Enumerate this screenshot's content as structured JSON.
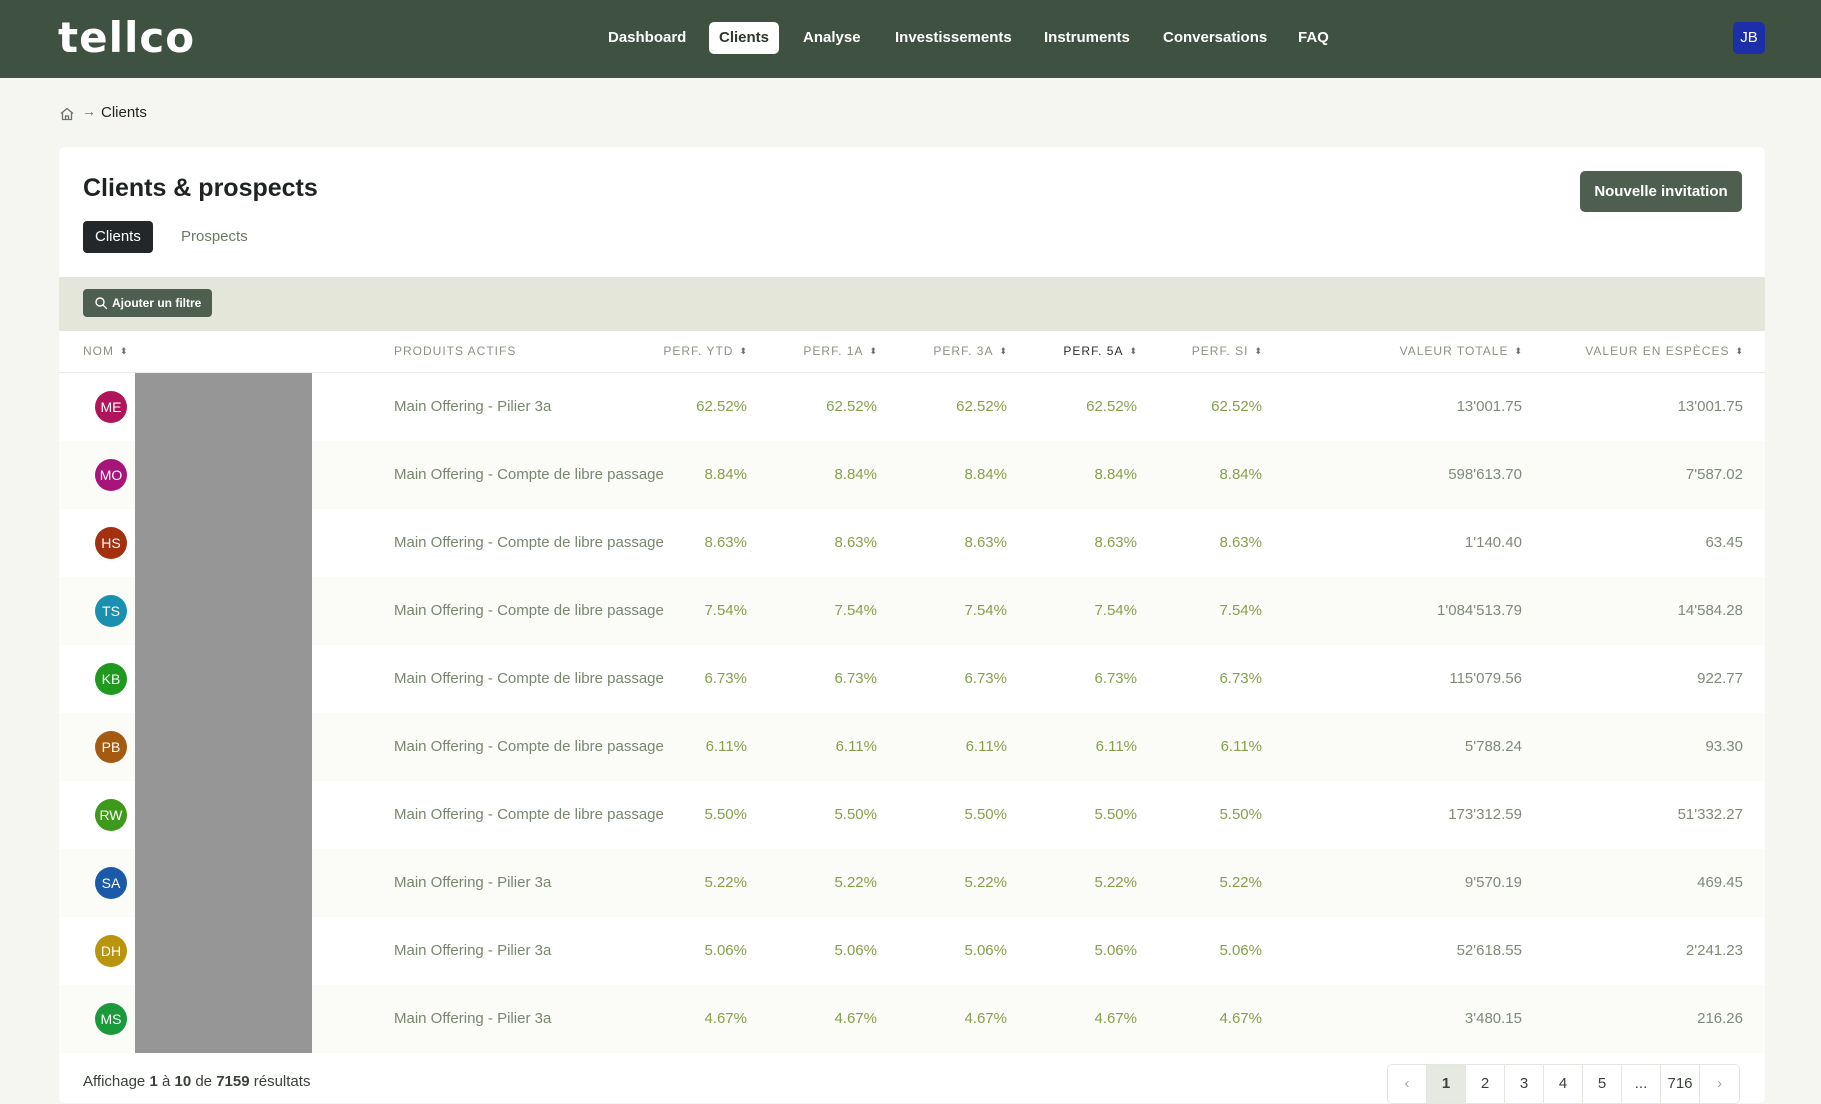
{
  "app": {
    "logo": "tellco"
  },
  "nav": {
    "items": [
      {
        "label": "Dashboard",
        "active": false
      },
      {
        "label": "Clients",
        "active": true
      },
      {
        "label": "Analyse",
        "active": false
      },
      {
        "label": "Investissements",
        "active": false
      },
      {
        "label": "Instruments",
        "active": false
      },
      {
        "label": "Conversations",
        "active": false
      },
      {
        "label": "FAQ",
        "active": false
      }
    ],
    "user_initials": "JB"
  },
  "breadcrumb": {
    "arrow": "→",
    "current": "Clients"
  },
  "page": {
    "title": "Clients & prospects",
    "invite_label": "Nouvelle invitation",
    "tabs": [
      {
        "label": "Clients",
        "active": true
      },
      {
        "label": "Prospects",
        "active": false
      }
    ],
    "filter_label": "Ajouter un filtre"
  },
  "table": {
    "columns": [
      {
        "label": "Nom"
      },
      {
        "label": "Produits actifs"
      },
      {
        "label": "Perf. YTD"
      },
      {
        "label": "Perf. 1A"
      },
      {
        "label": "Perf. 3A"
      },
      {
        "label": "Perf. 5A"
      },
      {
        "label": "Perf. SI"
      },
      {
        "label": "Valeur totale"
      },
      {
        "label": "Valeur en espèces"
      }
    ],
    "sort_icon": "⬍",
    "rows": [
      {
        "initials": "ME",
        "color": "#b0155a",
        "product": "Main Offering - Pilier 3a",
        "ytd": "62.52%",
        "p1a": "62.52%",
        "p3a": "62.52%",
        "p5a": "62.52%",
        "psi": "62.52%",
        "total": "13'001.75",
        "cash": "13'001.75"
      },
      {
        "initials": "MO",
        "color": "#a8157a",
        "product": "Main Offering - Compte de libre passage",
        "ytd": "8.84%",
        "p1a": "8.84%",
        "p3a": "8.84%",
        "p5a": "8.84%",
        "psi": "8.84%",
        "total": "598'613.70",
        "cash": "7'587.02"
      },
      {
        "initials": "HS",
        "color": "#a3300f",
        "product": "Main Offering - Compte de libre passage",
        "ytd": "8.63%",
        "p1a": "8.63%",
        "p3a": "8.63%",
        "p5a": "8.63%",
        "psi": "8.63%",
        "total": "1'140.40",
        "cash": "63.45"
      },
      {
        "initials": "TS",
        "color": "#1a8fb0",
        "product": "Main Offering - Compte de libre passage",
        "ytd": "7.54%",
        "p1a": "7.54%",
        "p3a": "7.54%",
        "p5a": "7.54%",
        "psi": "7.54%",
        "total": "1'084'513.79",
        "cash": "14'584.28"
      },
      {
        "initials": "KB",
        "color": "#1f9a1f",
        "product": "Main Offering - Compte de libre passage",
        "ytd": "6.73%",
        "p1a": "6.73%",
        "p3a": "6.73%",
        "p5a": "6.73%",
        "psi": "6.73%",
        "total": "115'079.56",
        "cash": "922.77"
      },
      {
        "initials": "PB",
        "color": "#a55a12",
        "product": "Main Offering - Compte de libre passage",
        "ytd": "6.11%",
        "p1a": "6.11%",
        "p3a": "6.11%",
        "p5a": "6.11%",
        "psi": "6.11%",
        "total": "5'788.24",
        "cash": "93.30"
      },
      {
        "initials": "RW",
        "color": "#3e9a1a",
        "product": "Main Offering - Compte de libre passage",
        "ytd": "5.50%",
        "p1a": "5.50%",
        "p3a": "5.50%",
        "p5a": "5.50%",
        "psi": "5.50%",
        "total": "173'312.59",
        "cash": "51'332.27"
      },
      {
        "initials": "SA",
        "color": "#1a5aa8",
        "product": "Main Offering - Pilier 3a",
        "ytd": "5.22%",
        "p1a": "5.22%",
        "p3a": "5.22%",
        "p5a": "5.22%",
        "psi": "5.22%",
        "total": "9'570.19",
        "cash": "469.45"
      },
      {
        "initials": "DH",
        "color": "#b8940f",
        "product": "Main Offering - Pilier 3a",
        "ytd": "5.06%",
        "p1a": "5.06%",
        "p3a": "5.06%",
        "p5a": "5.06%",
        "psi": "5.06%",
        "total": "52'618.55",
        "cash": "2'241.23"
      },
      {
        "initials": "MS",
        "color": "#1a9a3a",
        "product": "Main Offering - Pilier 3a",
        "ytd": "4.67%",
        "p1a": "4.67%",
        "p3a": "4.67%",
        "p5a": "4.67%",
        "psi": "4.67%",
        "total": "3'480.15",
        "cash": "216.26"
      }
    ]
  },
  "footer": {
    "prefix": "Affichage",
    "from": "1",
    "sep1": "à",
    "to": "10",
    "sep2": "de",
    "total": "7159",
    "suffix": "résultats"
  },
  "pagination": {
    "prev": "‹",
    "pages": [
      "1",
      "2",
      "3",
      "4",
      "5",
      "...",
      "716"
    ],
    "current": "1",
    "next": "›"
  }
}
